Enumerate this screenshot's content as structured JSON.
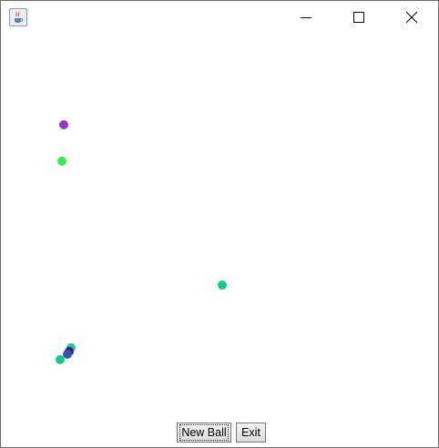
{
  "window": {
    "title": "",
    "icon": "java-cup-icon",
    "controls": {
      "minimize_icon": "minimize-icon",
      "maximize_icon": "maximize-icon",
      "close_icon": "close-icon"
    }
  },
  "buttons": {
    "new_ball": "New Ball",
    "exit": "Exit"
  },
  "colors": {
    "purple_ball": "#9933cc",
    "green_ball": "#33ee44",
    "teal_ball": "#11cc88",
    "blue_ball": "#3355aa",
    "navy_ball": "#332288"
  }
}
